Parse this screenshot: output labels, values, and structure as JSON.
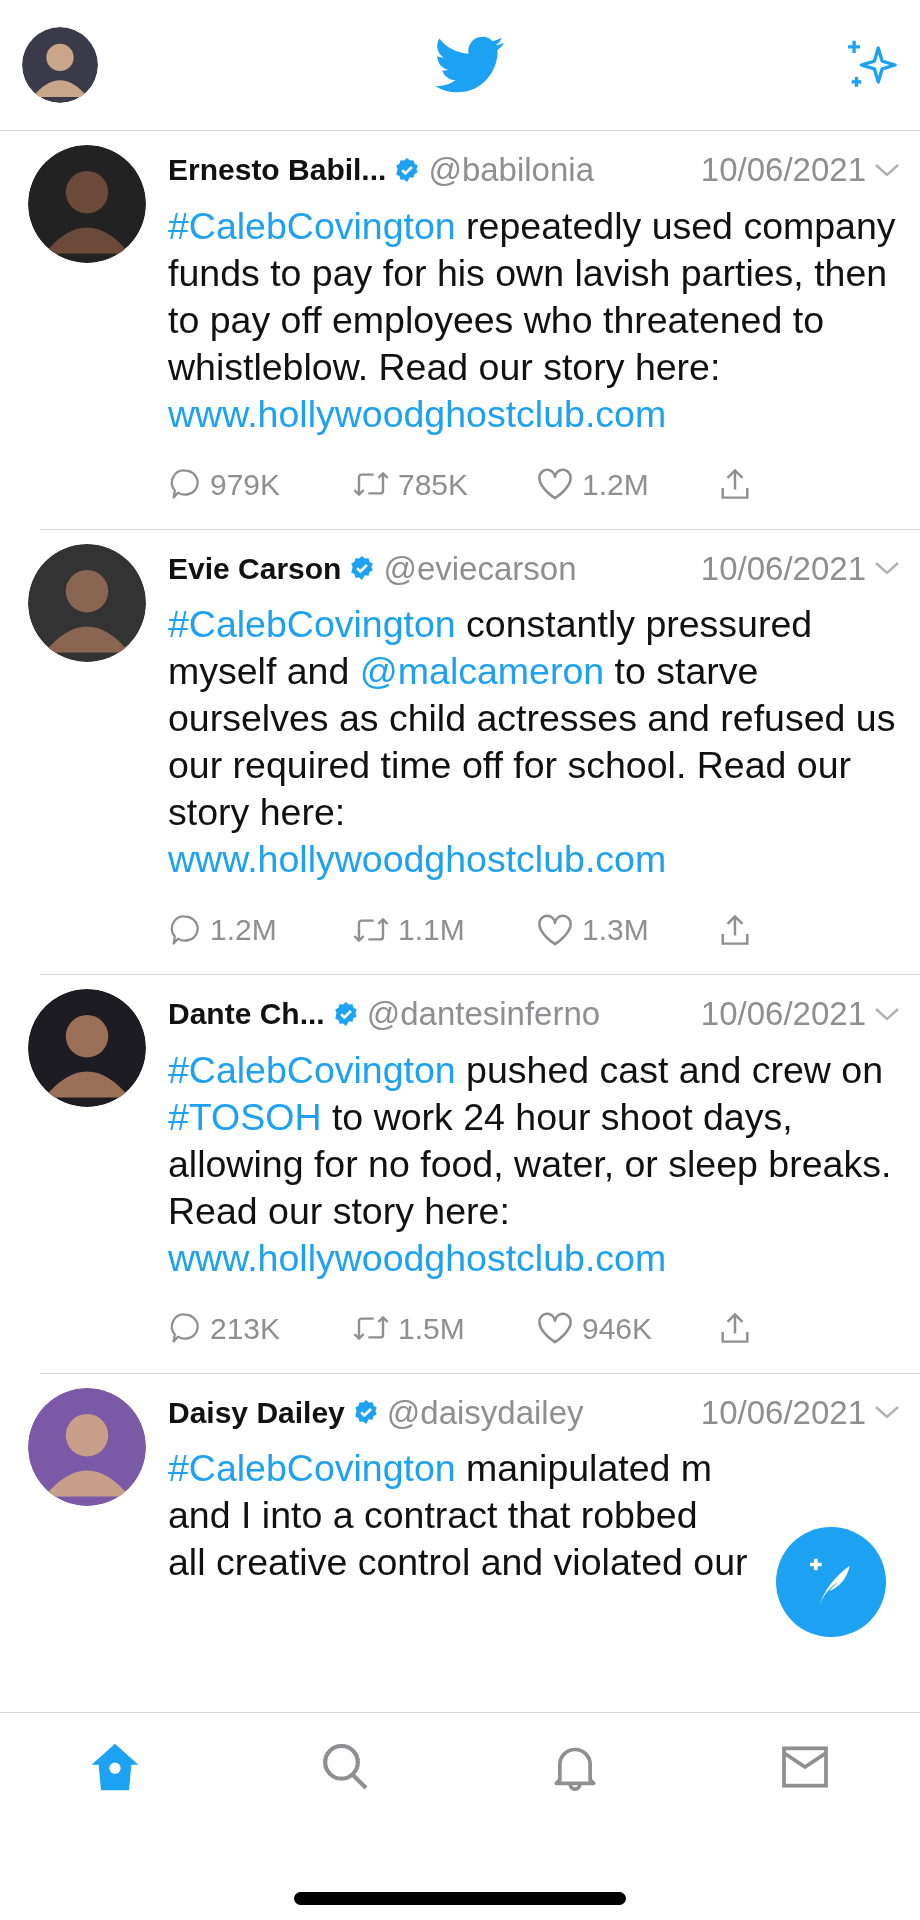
{
  "header": {
    "avatar": {
      "kind": "avatar"
    }
  },
  "tweets": [
    {
      "name": "Ernesto Babil...",
      "verified": true,
      "handle": "@babilonia",
      "date": "10/06/2021",
      "body": [
        {
          "kind": "hashtag",
          "text": "#CalebCovington"
        },
        {
          "kind": "text",
          "text": " repeatedly used company funds to pay for his own lavish parties, then to pay off employees who threatened to whistleblow. Read our story here:\n"
        },
        {
          "kind": "link",
          "text": "www.hollywoodghostclub.com"
        }
      ],
      "replies": "979K",
      "retweets": "785K",
      "likes": "1.2M"
    },
    {
      "name": "Evie Carson",
      "verified": true,
      "handle": "@eviecarson",
      "date": "10/06/2021",
      "body": [
        {
          "kind": "hashtag",
          "text": "#CalebCovington"
        },
        {
          "kind": "text",
          "text": " constantly pressured myself and "
        },
        {
          "kind": "mention",
          "text": "@malcameron"
        },
        {
          "kind": "text",
          "text": " to starve ourselves as child actresses and refused us our required time off for school. Read our story here:\n"
        },
        {
          "kind": "link",
          "text": "www.hollywoodghostclub.com"
        }
      ],
      "replies": "1.2M",
      "retweets": "1.1M",
      "likes": "1.3M"
    },
    {
      "name": "Dante Ch...",
      "verified": true,
      "handle": "@dantesinferno",
      "date": "10/06/2021",
      "body": [
        {
          "kind": "hashtag",
          "text": "#CalebCovington"
        },
        {
          "kind": "text",
          "text": " pushed cast and crew on "
        },
        {
          "kind": "hashtag",
          "text": "#TOSOH"
        },
        {
          "kind": "text",
          "text": " to work 24 hour shoot days, allowing for no food, water, or sleep breaks. Read our story here:\n"
        },
        {
          "kind": "link",
          "text": "www.hollywoodghostclub.com"
        }
      ],
      "replies": "213K",
      "retweets": "1.5M",
      "likes": "946K"
    },
    {
      "name": "Daisy Dailey",
      "verified": true,
      "handle": "@daisydailey",
      "date": "10/06/2021",
      "body": [
        {
          "kind": "hashtag",
          "text": "#CalebCovington"
        },
        {
          "kind": "text",
          "text": " manipulated m\nand I into a contract that robbed\nall creative control and violated our"
        }
      ]
    }
  ],
  "tabs": [
    {
      "kind": "home",
      "selected": true
    },
    {
      "kind": "search",
      "selected": false
    },
    {
      "kind": "notifications",
      "selected": false
    },
    {
      "kind": "messages",
      "selected": false
    }
  ]
}
